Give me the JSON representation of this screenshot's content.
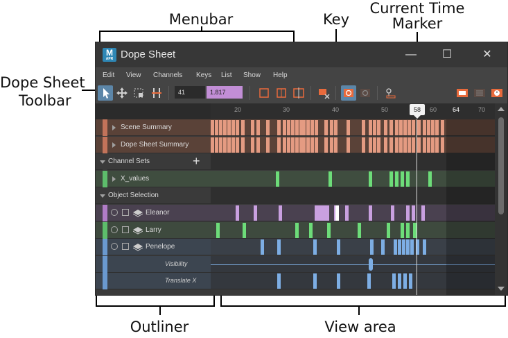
{
  "annotations": {
    "menubar": "Menubar",
    "key": "Key",
    "current_time_marker_line1": "Current Time",
    "current_time_marker_line2": "Marker",
    "toolbar_line1": "Dope Sheet",
    "toolbar_line2": "Toolbar",
    "outliner": "Outliner",
    "view_area": "View area"
  },
  "window": {
    "title": "Dope Sheet",
    "app_icon": "M",
    "app_icon_sub": "APR",
    "minimize_icon": "minimize-icon",
    "maximize_icon": "maximize-icon",
    "close_icon": "close-icon",
    "minimize_glyph": "—",
    "maximize_glyph": "☐",
    "close_glyph": "✕"
  },
  "menu": [
    "Edit",
    "View",
    "Channels",
    "Keys",
    "List",
    "Show",
    "Help"
  ],
  "toolbar": {
    "current_frame": "41",
    "value_field": "1.817"
  },
  "timeline": {
    "ticks": [
      "20",
      "30",
      "40",
      "50",
      "60",
      "64",
      "70"
    ],
    "current_time": "58"
  },
  "outliner": {
    "rows": [
      {
        "label": "Scene Summary",
        "color": "#c2735a"
      },
      {
        "label": "Dope Sheet Summary",
        "color": "#c2735a"
      },
      {
        "label": "Channel Sets",
        "color": "#3a3a3a"
      },
      {
        "label": "X_values",
        "color": "#5dbd6b"
      },
      {
        "label": "Object Selection",
        "color": "#3a3a3a"
      },
      {
        "label": "Eleanor",
        "color": "#b07cc6"
      },
      {
        "label": "Larry",
        "color": "#5dbd6b"
      },
      {
        "label": "Penelope",
        "color": "#6a99cf"
      },
      {
        "label": "Visibility",
        "color": "#6a99cf"
      },
      {
        "label": "Translate X",
        "color": "#6a99cf"
      }
    ]
  },
  "colors": {
    "summary_key": "#e49b82",
    "green_key": "#6ddc79",
    "purple_key": "#c9a0e0",
    "blue_key": "#7daee4",
    "selected_key": "#ffffff",
    "accent_orange": "#e86a3c"
  }
}
